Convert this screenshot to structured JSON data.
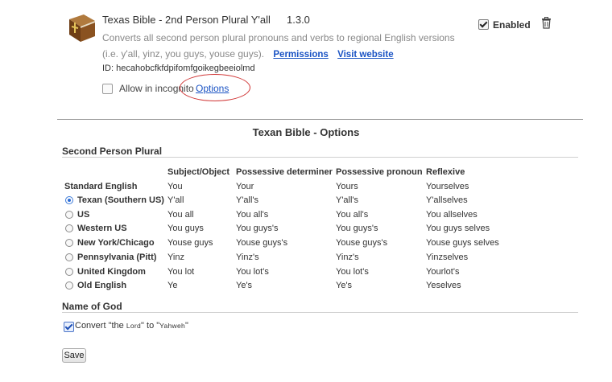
{
  "extension": {
    "name": "Texas Bible - 2nd Person Plural Y'all",
    "version": "1.3.0",
    "description": "Converts all second person plural pronouns and verbs to regional English versions (i.e. y'all, yinz, you guys, youse guys).",
    "permissions_label": "Permissions",
    "website_label": "Visit website",
    "id_text": "ID: hecahobcfkfdpifomfgoikegbeeiolmd",
    "incognito_label": "Allow in incognito",
    "options_label": "Options",
    "enabled_label": "Enabled",
    "enabled": true,
    "incognito_allowed": false
  },
  "options_page": {
    "title": "Texan Bible - Options",
    "section1_title": "Second Person Plural",
    "columns": [
      "Subject/Object",
      "Possessive determiner",
      "Possessive pronoun",
      "Reflexive"
    ],
    "standard": {
      "label": "Standard English",
      "values": [
        "You",
        "Your",
        "Yours",
        "Yourselves"
      ]
    },
    "rows": [
      {
        "label": "Texan (Southern US)",
        "selected": true,
        "values": [
          "Y'all",
          "Y'all's",
          "Y'all's",
          "Y'allselves"
        ]
      },
      {
        "label": "US",
        "selected": false,
        "values": [
          "You all",
          "You all's",
          "You all's",
          "You allselves"
        ]
      },
      {
        "label": "Western US",
        "selected": false,
        "values": [
          "You guys",
          "You guys's",
          "You guys's",
          "You guys selves"
        ]
      },
      {
        "label": "New York/Chicago",
        "selected": false,
        "values": [
          "Youse guys",
          "Youse guys's",
          "Youse guys's",
          "Youse guys selves"
        ]
      },
      {
        "label": "Pennsylvania (Pitt)",
        "selected": false,
        "values": [
          "Yinz",
          "Yinz's",
          "Yinz's",
          "Yinzselves"
        ]
      },
      {
        "label": "United Kingdom",
        "selected": false,
        "values": [
          "You lot",
          "You lot's",
          "You lot's",
          "Yourlot's"
        ]
      },
      {
        "label": "Old English",
        "selected": false,
        "values": [
          "Ye",
          "Ye's",
          "Ye's",
          "Yeselves"
        ]
      }
    ],
    "section2_title": "Name of God",
    "convert_prefix": "Convert \"the ",
    "convert_lord": "Lord",
    "convert_middle": "\" to \"",
    "convert_yahweh": "Yahweh",
    "convert_suffix": "\"",
    "convert_checked": true,
    "save_label": "Save"
  }
}
